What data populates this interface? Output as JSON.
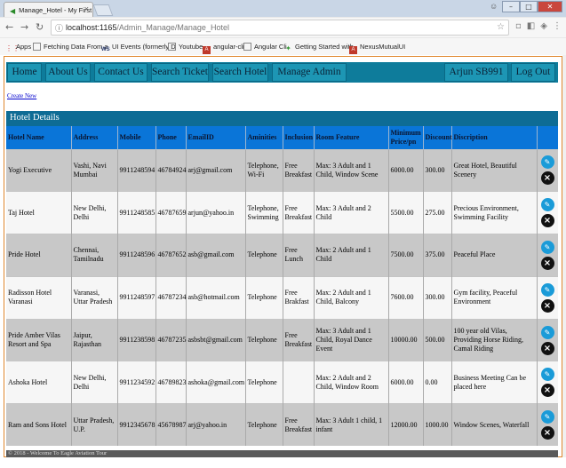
{
  "browser": {
    "tab_title": "Manage_Hotel - My First",
    "url_host": "localhost:1165",
    "url_path": "/Admin_Manage/Manage_Hotel",
    "bookmarks": [
      {
        "label": "Apps",
        "icon": "apps-grid-icon"
      },
      {
        "label": "Fetching Data From a",
        "icon": "page-icon"
      },
      {
        "label": "UI Events (formerly D",
        "icon": "ws-icon"
      },
      {
        "label": "Youtube",
        "icon": "page-icon"
      },
      {
        "label": "angular-cli",
        "icon": "angular-icon"
      },
      {
        "label": "Angular Cli",
        "icon": "page-icon"
      },
      {
        "label": "Getting Started with",
        "icon": "leaf-icon"
      },
      {
        "label": "NexusMutualUI",
        "icon": "angular-icon"
      }
    ]
  },
  "nav": {
    "home": "Home",
    "about": "About Us",
    "contact": "Contact Us",
    "search_ticket": "Search Ticket",
    "search_hotel": "Search Hotel",
    "manage_admin": "Manage Admin",
    "user": "Arjun  SB991",
    "logout": "Log Out"
  },
  "create_new": "Create New",
  "table_title": "Hotel Details",
  "columns": [
    "Hotel Name",
    "Address",
    "Mobile",
    "Phone",
    "EmailID",
    "Aminities",
    "Inclusion",
    "Room Feature",
    "Minimum Price/pn",
    "Discount",
    "Discription",
    ""
  ],
  "rows": [
    [
      "Yogi Executive",
      "Vashi, Navi Mumbai",
      "9911248594",
      "46784924",
      "arj@gmail.com",
      "Telephone, Wi-Fi",
      "Free Breakfast",
      "Max: 3 Adult and 1 Child, Window Scene",
      "6000.00",
      "300.00",
      "Great Hotel, Beautiful Scenery"
    ],
    [
      "Taj Hotel",
      "New Delhi, Delhi",
      "9911248585",
      "46787659",
      "arjun@yahoo.in",
      "Telephone, Swimming",
      "Free Breakfast",
      "Max: 3 Adult and 2 Child",
      "5500.00",
      "275.00",
      "Precious Environment, Swimming Facility"
    ],
    [
      "Pride Hotel",
      "Chennai, Tamilnadu",
      "9911248596",
      "46787652",
      "asb@gmail.com",
      "Telephone",
      "Free Lunch",
      "Max: 2 Adult and 1 Child",
      "7500.00",
      "375.00",
      "Peaceful Place"
    ],
    [
      "Radisson Hotel Varanasi",
      "Varanasi, Uttar Pradesh",
      "9911248597",
      "46787234",
      "asb@hotmail.com",
      "Telephone",
      "Free Brakfast",
      "Max: 2 Adult and 1 Child, Balcony",
      "7600.00",
      "300.00",
      "Gym facility, Peaceful Environment"
    ],
    [
      "Pride Amber Vilas Resort and Spa",
      "Jaipur, Rajasthan",
      "9911238598",
      "46787235",
      "asbsbt@gmail.com",
      "Telephone",
      "Free Breakfast",
      "Max: 3 Adult and 1 Child, Royal Dance Event",
      "10000.00",
      "500.00",
      "100 year old Vilas, Providing Horse Riding, Camal Riding"
    ],
    [
      "Ashoka Hotel",
      "New Delhi, Delhi",
      "9911234592",
      "46789823",
      "ashoka@gmail.com",
      "Telephone",
      "",
      "Max: 2 Adult and 2 Child, Window Room",
      "6000.00",
      "0.00",
      "Business Meeting Can be placed here"
    ],
    [
      "Ram and Sons Hotel",
      "Uttar Pradesh, U.P.",
      "9912345678",
      "45678987",
      "arj@yahoo.in",
      "Telephone",
      "Free Breakfast",
      "Max: 3 Adult 1 child, 1 infant",
      "12000.00",
      "1000.00",
      "Window Scenes, Waterfall"
    ]
  ],
  "footer": "© 2018 - Welcome To Eagle Aviation Tour"
}
